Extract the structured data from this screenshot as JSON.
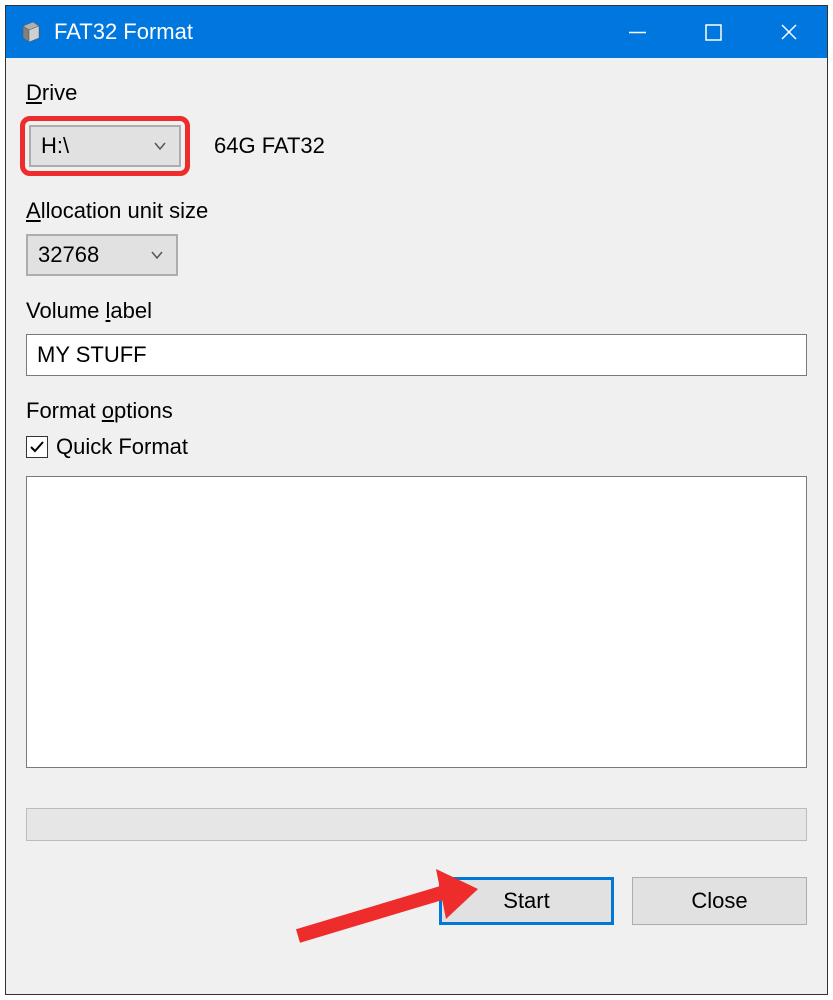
{
  "window": {
    "title": "FAT32 Format"
  },
  "drive": {
    "label_pre": "D",
    "label_post": "rive",
    "selected": "H:\\",
    "info": "64G FAT32"
  },
  "allocation": {
    "label_pre": "A",
    "label_post": "llocation unit size",
    "selected": "32768"
  },
  "volume": {
    "label_pre": "Volume ",
    "label_mid": "l",
    "label_post": "abel",
    "value": "MY STUFF"
  },
  "format_options": {
    "label_pre": "Format ",
    "label_mid": "o",
    "label_post": "ptions",
    "quick_format_label": "Quick Format",
    "quick_format_checked": true
  },
  "buttons": {
    "start": "Start",
    "close": "Close"
  }
}
